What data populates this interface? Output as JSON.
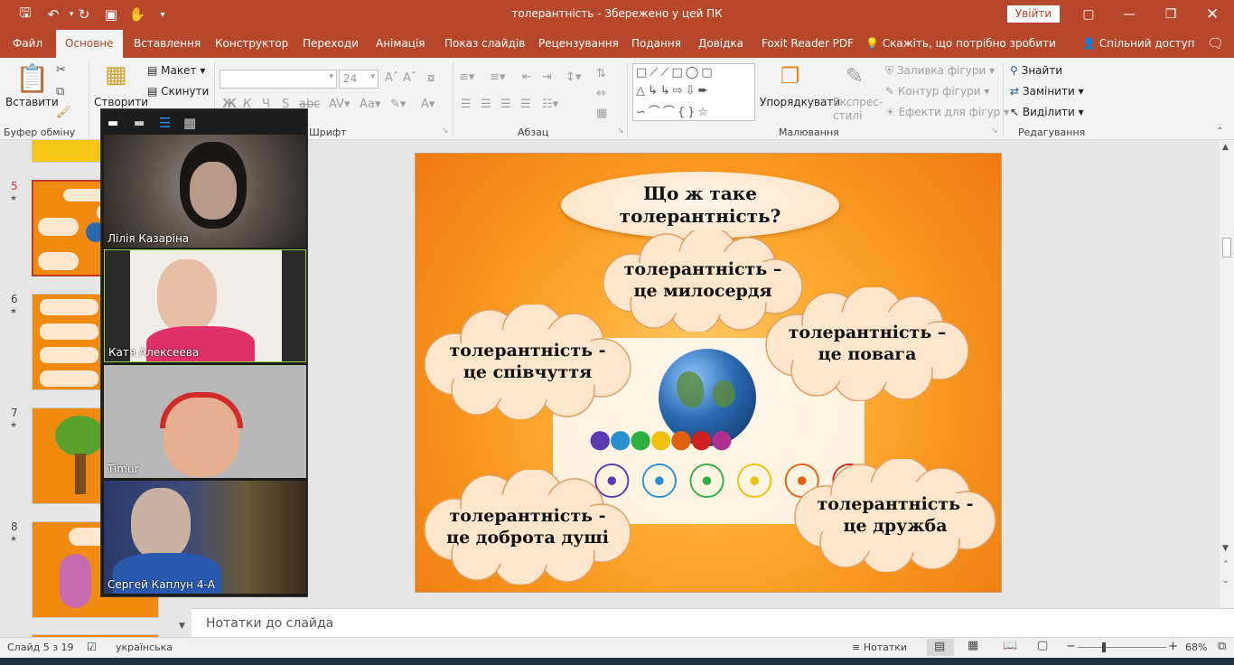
{
  "window": {
    "title": "толерантність  -  Збережено у цей ПК",
    "signin_label": "Увійти"
  },
  "tabs": [
    {
      "label": "Файл",
      "active": false
    },
    {
      "label": "Основне",
      "active": true
    },
    {
      "label": "Вставлення",
      "active": false
    },
    {
      "label": "Конструктор",
      "active": false
    },
    {
      "label": "Переходи",
      "active": false
    },
    {
      "label": "Анімація",
      "active": false
    },
    {
      "label": "Показ слайдів",
      "active": false
    },
    {
      "label": "Рецензування",
      "active": false
    },
    {
      "label": "Подання",
      "active": false
    },
    {
      "label": "Довідка",
      "active": false
    },
    {
      "label": "Foxit Reader PDF",
      "active": false
    }
  ],
  "tell_me": "Скажіть, що потрібно зробити",
  "share": "Спільний доступ",
  "ribbon": {
    "clipboard": {
      "paste": "Вставити",
      "group": "Буфер обміну"
    },
    "slides": {
      "new_slide": "Створити",
      "layout": "Макет",
      "reset": "Скинути"
    },
    "font": {
      "group": "Шрифт",
      "font_name": "",
      "font_size": "24",
      "bold": "Ж",
      "italic": "К",
      "underline": "Ч"
    },
    "paragraph": {
      "group": "Абзац"
    },
    "drawing": {
      "group": "Малювання",
      "arrange": "Упорядкувати",
      "quick_styles": "Експрес-\nстилі",
      "fill": "Заливка фігури",
      "outline": "Контур фігури",
      "effects": "Ефекти для фігур"
    },
    "editing": {
      "group": "Редагування",
      "find": "Знайти",
      "replace": "Замінити",
      "select": "Виділити"
    }
  },
  "thumbnails": [
    {
      "number": "5",
      "active": true
    },
    {
      "number": "6",
      "active": false
    },
    {
      "number": "7",
      "active": false
    },
    {
      "number": "8",
      "active": false
    }
  ],
  "video_participants": [
    {
      "name": "Лілія Казаріна"
    },
    {
      "name": "Катя Алексеева"
    },
    {
      "name": "Timur"
    },
    {
      "name": "Сергей Каплун 4-А"
    }
  ],
  "slide": {
    "title": "Що ж таке толерантність?",
    "clouds": [
      "толерантність – це милосердя",
      "толерантність - це співчуття",
      "толерантність – це повага",
      "толерантність - це доброта душі",
      "толерантність - це дружба"
    ]
  },
  "notes_placeholder": "Нотатки до слайда",
  "status": {
    "slide_counter": "Слайд 5 з 19",
    "language": "українська",
    "notes": "Нотатки",
    "zoom": "68%"
  },
  "colors": {
    "accent": "#b7472a",
    "slide_bg": "#f7941d"
  }
}
